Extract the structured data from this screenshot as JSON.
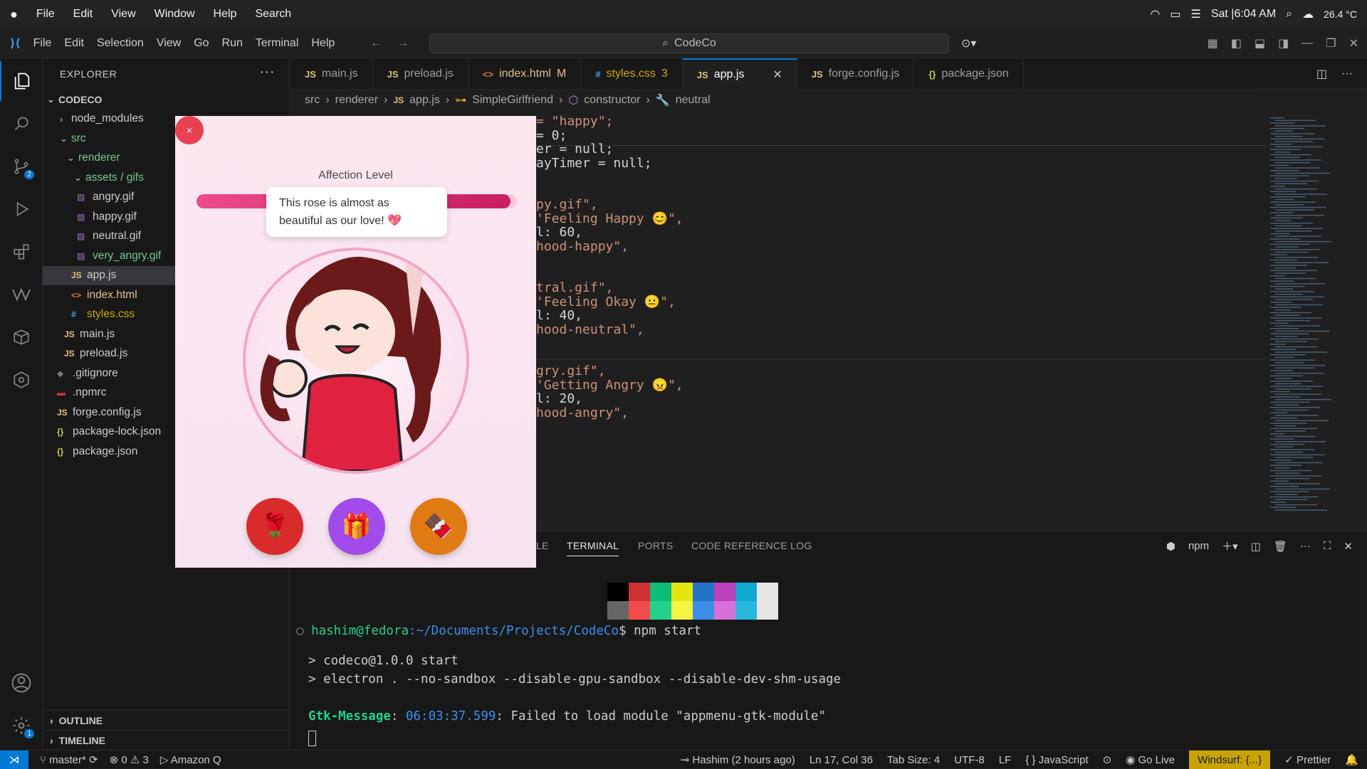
{
  "macbar": {
    "menus": [
      "File",
      "Edit",
      "View",
      "Window",
      "Help",
      "Search"
    ],
    "clock": "Sat |6:04 AM",
    "temp": "26.4 °C"
  },
  "titlebar": {
    "menus": [
      "File",
      "Edit",
      "Selection",
      "View",
      "Go",
      "Run",
      "Terminal",
      "Help"
    ],
    "search": "CodeCo"
  },
  "activity": {
    "scm_badge": "2",
    "settings_badge": "1"
  },
  "explorer": {
    "title": "EXPLORER",
    "project": "CODECO",
    "items": [
      "node_modules",
      "src",
      "renderer",
      "assets / gifs",
      "angry.gif",
      "happy.gif",
      "neutral.gif",
      "very_angry.gif",
      "app.js",
      "index.html",
      "styles.css",
      "main.js",
      "preload.js",
      ".gitignore",
      ".npmrc",
      "forge.config.js",
      "package-lock.json",
      "package.json"
    ],
    "outline": "OUTLINE",
    "timeline": "TIMELINE"
  },
  "tabs": [
    {
      "label": "main.js",
      "icon": "JS"
    },
    {
      "label": "preload.js",
      "icon": "JS"
    },
    {
      "label": "index.html",
      "icon": "<>",
      "mod": "M"
    },
    {
      "label": "styles.css",
      "icon": "#",
      "mod": "3"
    },
    {
      "label": "app.js",
      "icon": "JS"
    },
    {
      "label": "forge.config.js",
      "icon": "JS"
    },
    {
      "label": "package.json",
      "icon": "{}"
    }
  ],
  "breadcrumb": [
    "src",
    "renderer",
    "app.js",
    "SimpleGirlfriend",
    "constructor",
    "neutral"
  ],
  "code": [
    "= \"happy\";",
    "= 0;",
    "er = null;",
    "ayTimer = null;",
    "",
    "",
    "py.gif\",",
    "'Feeling Happy 😊\",",
    "l: 60,",
    "hood-happy\",",
    "",
    "",
    "tral.gif\",",
    "'Feeling Okay 😐\",",
    "l: 40,",
    "hood-neutral\",",
    "",
    "",
    "gry.gif\",",
    "'Getting Angry 😠\",",
    "l: 20,",
    "hood-angry\","
  ],
  "panel": {
    "tabs": [
      "LE",
      "TERMINAL",
      "PORTS",
      "CODE REFERENCE LOG"
    ],
    "shell": "npm",
    "prompt_user": "hashim@fedora",
    "prompt_path": ":~/Documents/Projects/CodeCo",
    "prompt_cmd": "$ npm start",
    "line1": "> codeco@1.0.0 start",
    "line2": "> electron . --no-sandbox --disable-gpu-sandbox --disable-dev-shm-usage",
    "gtk_label": "Gtk-Message",
    "gtk_time": "06:03:37.599",
    "gtk_msg": ": Failed to load module \"appmenu-gtk-module\""
  },
  "status": {
    "branch": "master*",
    "problems": "0",
    "warnings": "3",
    "amazonq": "Amazon Q",
    "blame": "Hashim (2 hours ago)",
    "pos": "Ln 17, Col 36",
    "tab": "Tab Size: 4",
    "enc": "UTF-8",
    "eol": "LF",
    "lang": "JavaScript",
    "golive": "Go Live",
    "windsurf": "Windsurf: {...}",
    "prettier": "Prettier"
  },
  "app": {
    "close": "×",
    "affection_label": "Affection Level",
    "affection_level": 0.98,
    "bubble": "This rose is almost as beautiful as our love! 💖",
    "buttons": [
      {
        "icon": "rose",
        "glyph": "🌹"
      },
      {
        "icon": "gift",
        "glyph": "🎁"
      },
      {
        "icon": "chocolate",
        "glyph": "🍫"
      }
    ]
  }
}
